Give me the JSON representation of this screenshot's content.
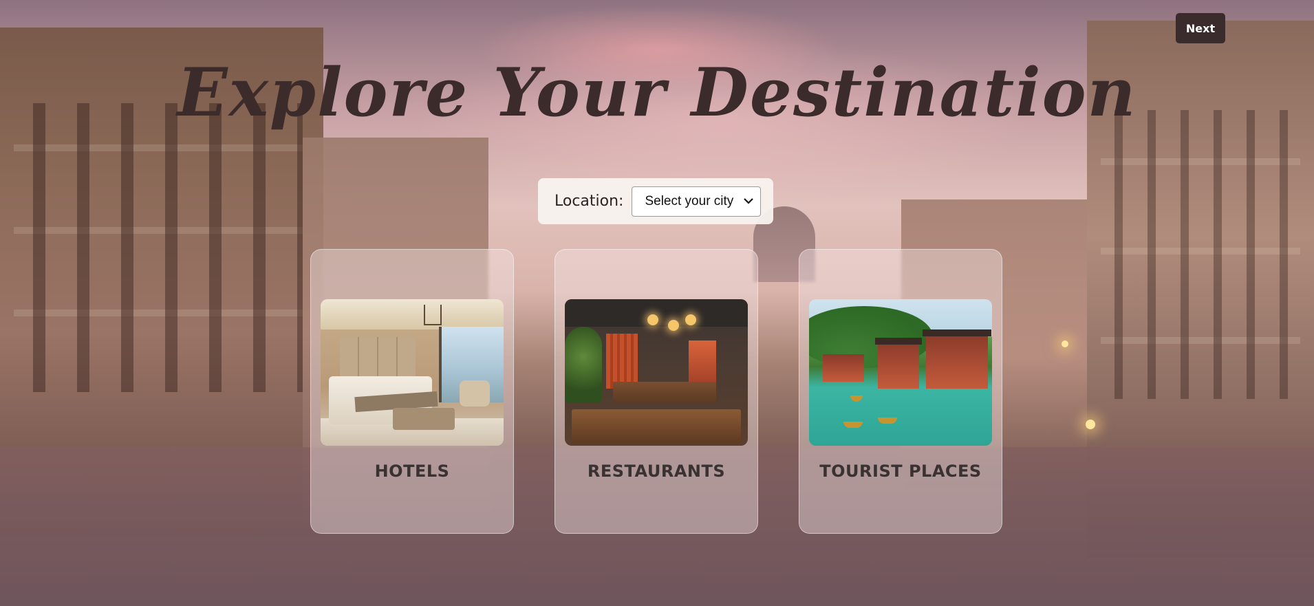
{
  "header": {
    "next_label": "Next"
  },
  "hero": {
    "title": "Explore Your Destination"
  },
  "location": {
    "label": "Location:",
    "selected": "Select your city"
  },
  "cards": [
    {
      "label": "HOTELS",
      "image": "hotel-room-photo"
    },
    {
      "label": "RESTAURANTS",
      "image": "restaurant-interior-photo"
    },
    {
      "label": "TOURIST PLACES",
      "image": "riverside-town-photo"
    }
  ],
  "colors": {
    "button_bg": "#3a2c2c",
    "title": "#3b2b2b",
    "card_text": "#3a3232"
  }
}
